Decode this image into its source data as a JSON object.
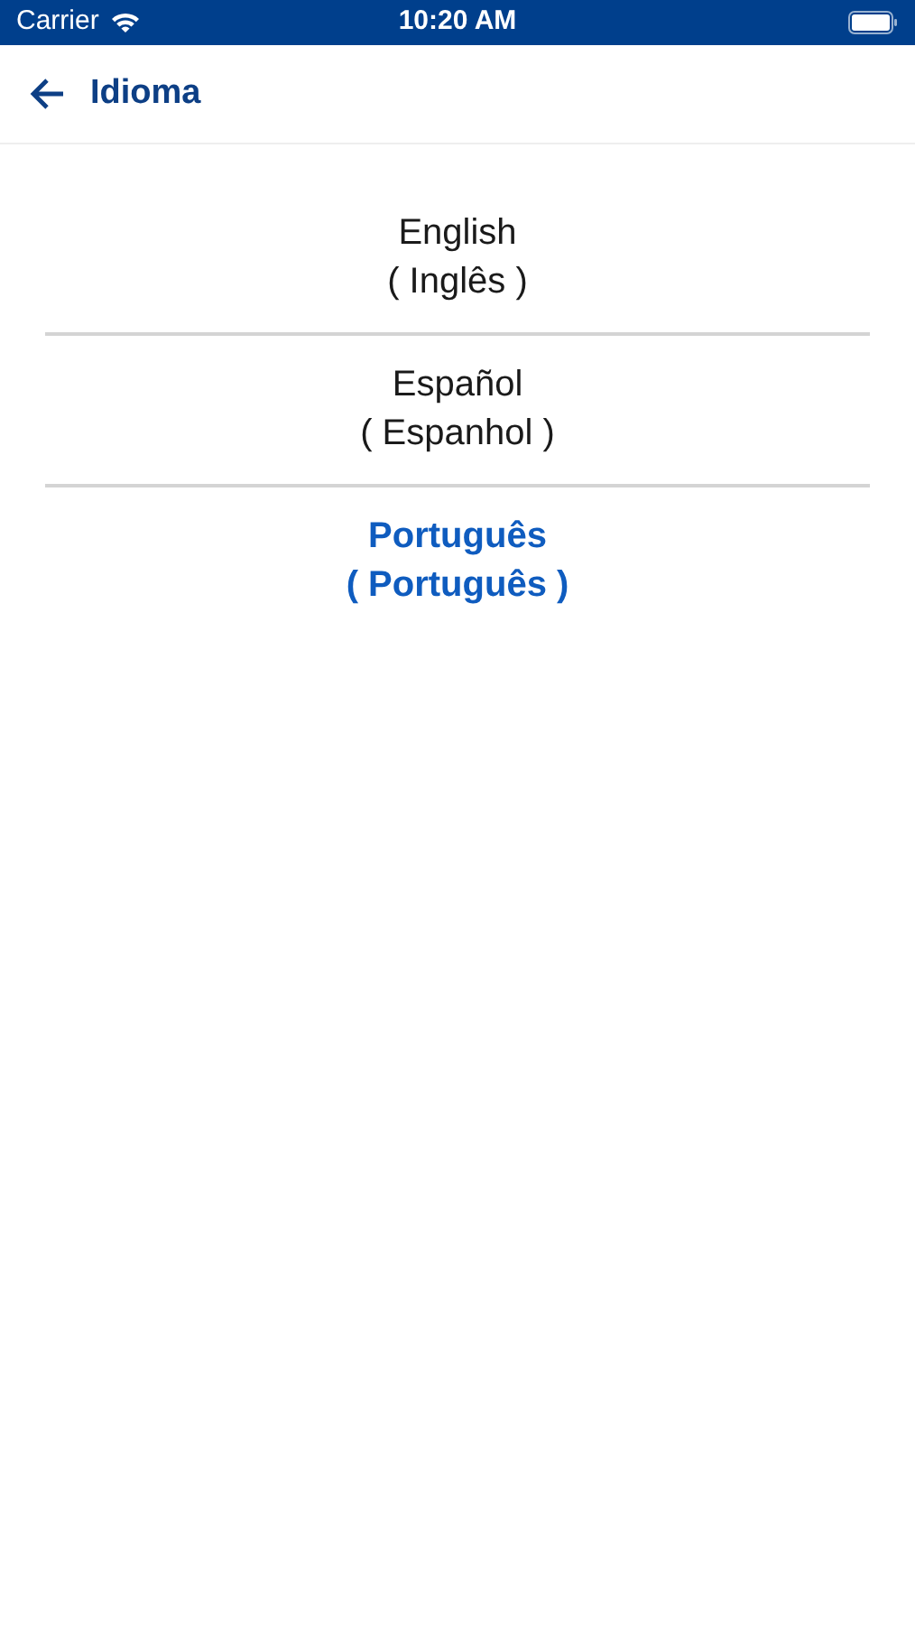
{
  "status_bar": {
    "carrier": "Carrier",
    "time": "10:20 AM"
  },
  "header": {
    "title": "Idioma"
  },
  "languages": [
    {
      "name": "English",
      "translation": "( Inglês )",
      "selected": false
    },
    {
      "name": "Español",
      "translation": "( Espanhol )",
      "selected": false
    },
    {
      "name": "Português",
      "translation": "( Português )",
      "selected": true
    }
  ]
}
